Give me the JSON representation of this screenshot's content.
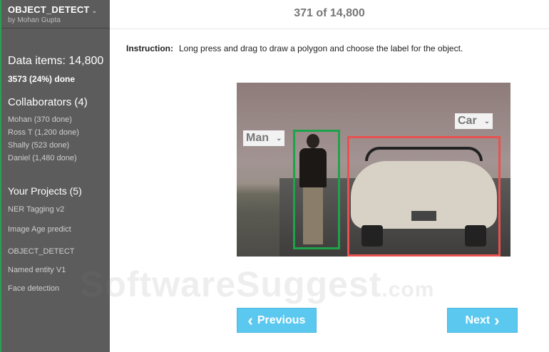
{
  "sidebar": {
    "project": "OBJECT_DETECT",
    "project_chevron": "⌄",
    "owner": "by Mohan Gupta",
    "data_items": "Data items: 14,800",
    "done": "3573 (24%) done",
    "collab_title": "Collaborators (4)",
    "collaborators": [
      "Mohan (370 done)",
      "Ross T (1,200 done)",
      "Shally (523 done)",
      "Daniel (1,480 done)"
    ],
    "projects_title": "Your Projects (5)",
    "projects": [
      "NER Tagging v2",
      "Image Age predict",
      "OBJECT_DETECT",
      "Named entity V1",
      "Face detection"
    ]
  },
  "main": {
    "counter": "371 of 14,800",
    "instruction_label": "Instruction:",
    "instruction": "Long press and drag to draw a polygon and choose the label for the object.",
    "labels": {
      "man": "Man",
      "car": "Car",
      "chevron": "⌄"
    },
    "prev": "Previous",
    "next": "Next",
    "prev_icon": "‹",
    "next_icon": "›"
  },
  "watermark": {
    "text": "SoftwareSuggest",
    ".com": ".com"
  },
  "colors": {
    "accent": "#5bc8ef",
    "man_box": "#1fa34a",
    "car_box": "#e8514f"
  }
}
